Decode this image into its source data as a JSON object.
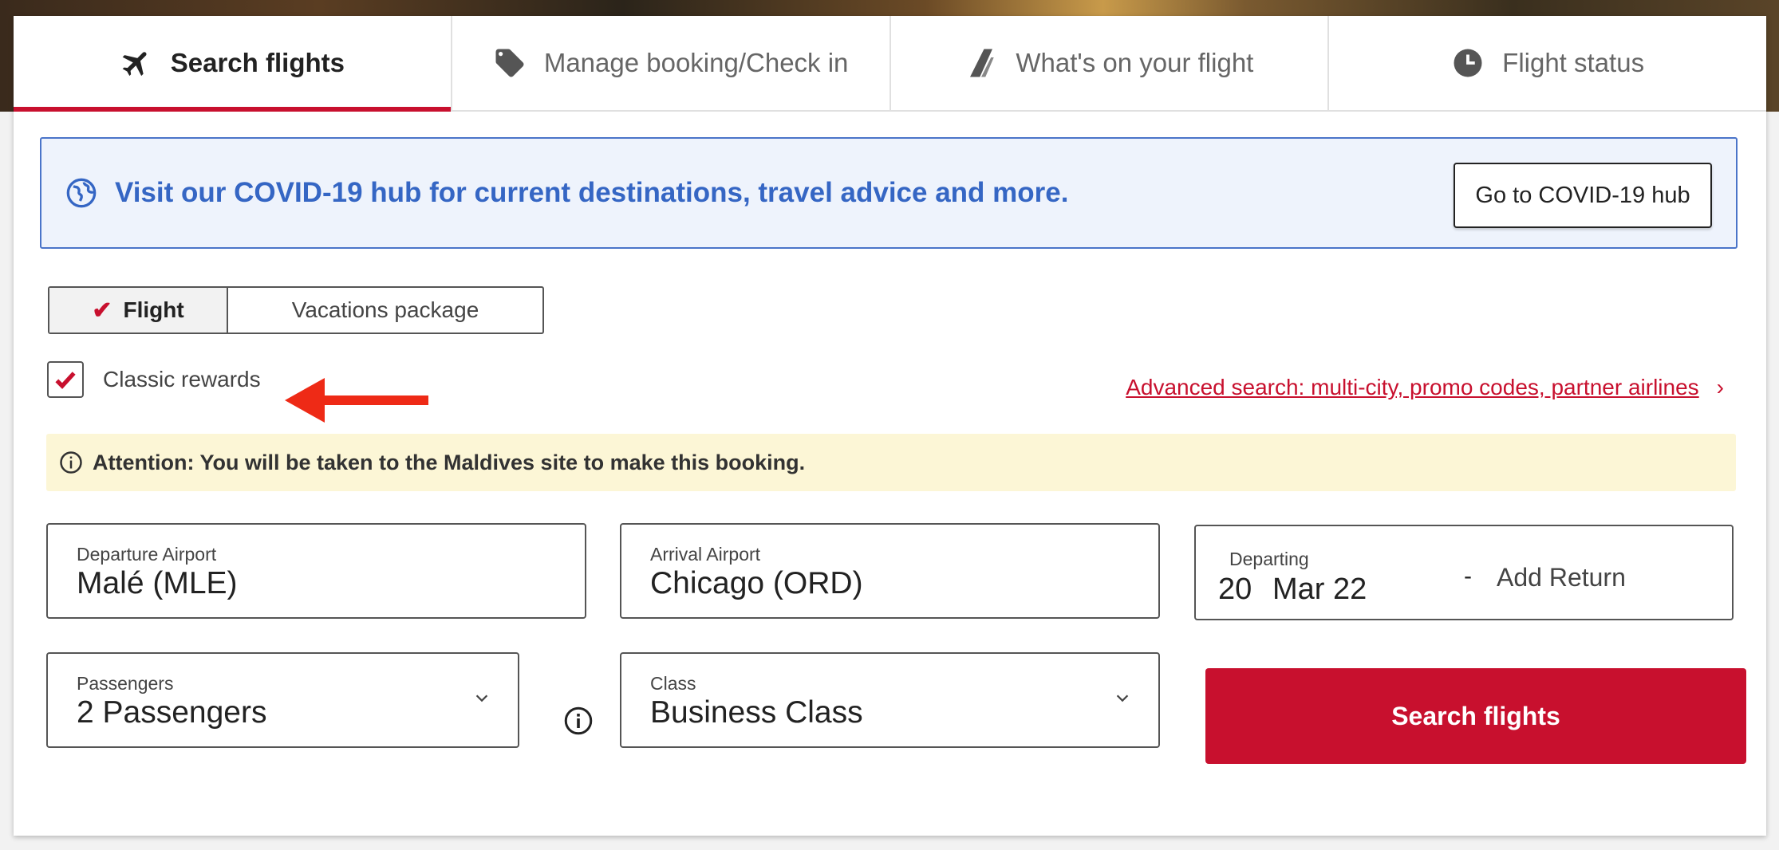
{
  "tabs": [
    {
      "label": "Search flights",
      "icon": "plane-icon",
      "active": true
    },
    {
      "label": "Manage booking/Check in",
      "icon": "tag-icon",
      "active": false
    },
    {
      "label": "What's on your flight",
      "icon": "tail-fin-icon",
      "active": false
    },
    {
      "label": "Flight status",
      "icon": "clock-icon",
      "active": false
    }
  ],
  "covid": {
    "message": "Visit our COVID-19 hub for current destinations, travel advice and more.",
    "button_label": "Go to COVID-19 hub"
  },
  "trip_type": {
    "options": [
      "Flight",
      "Vacations package"
    ],
    "selected": "Flight"
  },
  "classic_rewards": {
    "label": "Classic rewards",
    "checked": true
  },
  "advanced_search": {
    "link_text": "Advanced search: multi-city, promo codes, partner airlines"
  },
  "attention": {
    "text": "Attention: You will be taken to the Maldives site to make this booking."
  },
  "departure": {
    "label": "Departure Airport",
    "value": "Malé (MLE)"
  },
  "arrival": {
    "label": "Arrival Airport",
    "value": "Chicago (ORD)"
  },
  "departing": {
    "label": "Departing",
    "day": "20",
    "month_year": "Mar 22",
    "separator": "-",
    "return_text": "Add Return"
  },
  "passengers": {
    "label": "Passengers",
    "value": "2 Passengers"
  },
  "class": {
    "label": "Class",
    "value": "Business Class"
  },
  "search_button": {
    "label": "Search flights"
  },
  "colors": {
    "brand_red": "#c8102e",
    "covid_blue": "#3566c4",
    "attention_bg": "#fcf6d6"
  }
}
